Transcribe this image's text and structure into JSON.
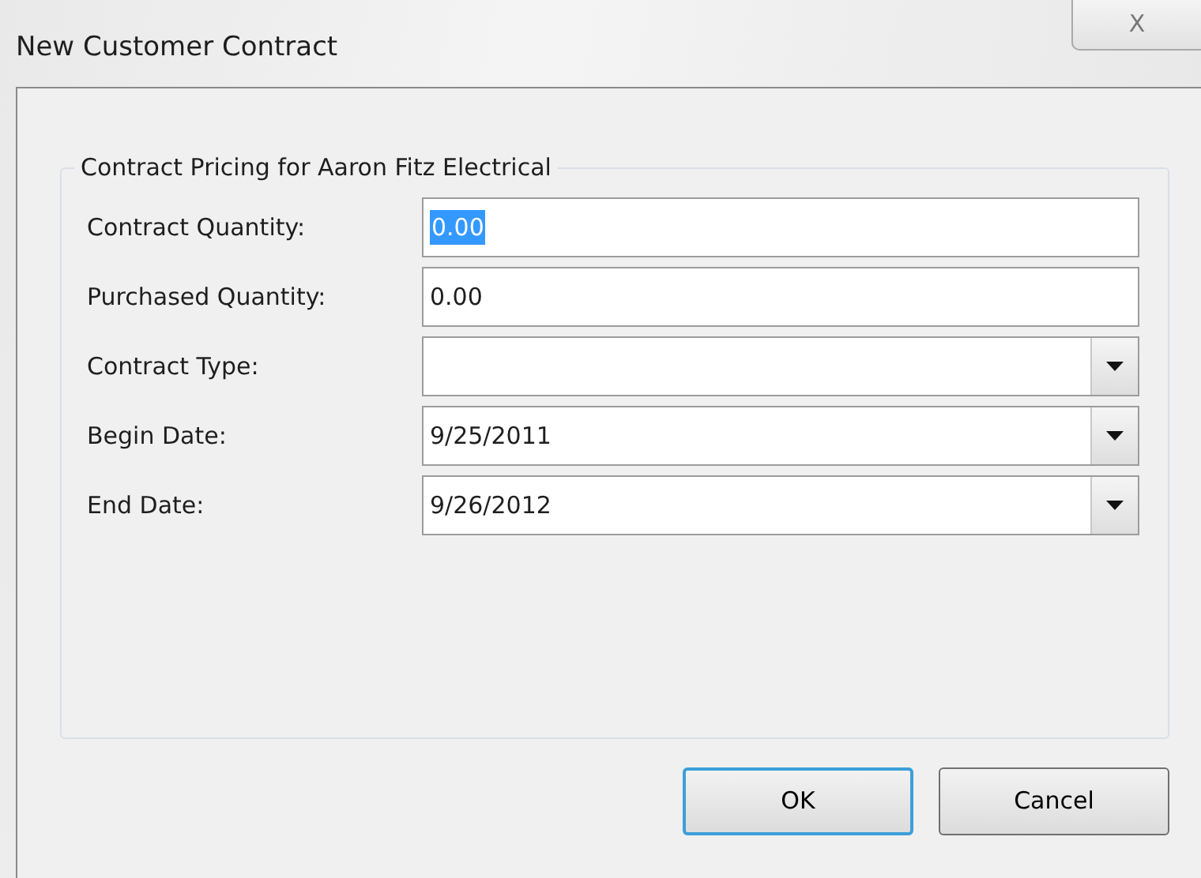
{
  "window": {
    "title": "New Customer Contract",
    "close_label": "X"
  },
  "group": {
    "title": "Contract Pricing for Aaron Fitz Electrical"
  },
  "fields": [
    {
      "label": "Contract Quantity:",
      "kind": "text",
      "value": "0.00",
      "highlighted": true
    },
    {
      "label": "Purchased Quantity:",
      "kind": "text",
      "value": "0.00",
      "highlighted": false
    },
    {
      "label": "Contract Type:",
      "kind": "dropdown"
    },
    {
      "label": "Begin Date:",
      "kind": "dropdown",
      "value": "9/25/2011"
    },
    {
      "label": "End Date:",
      "kind": "dropdown",
      "value": "9/26/2012"
    }
  ],
  "buttons": [
    {
      "label": "OK",
      "default": true
    },
    {
      "label": "Cancel",
      "default": false
    }
  ]
}
